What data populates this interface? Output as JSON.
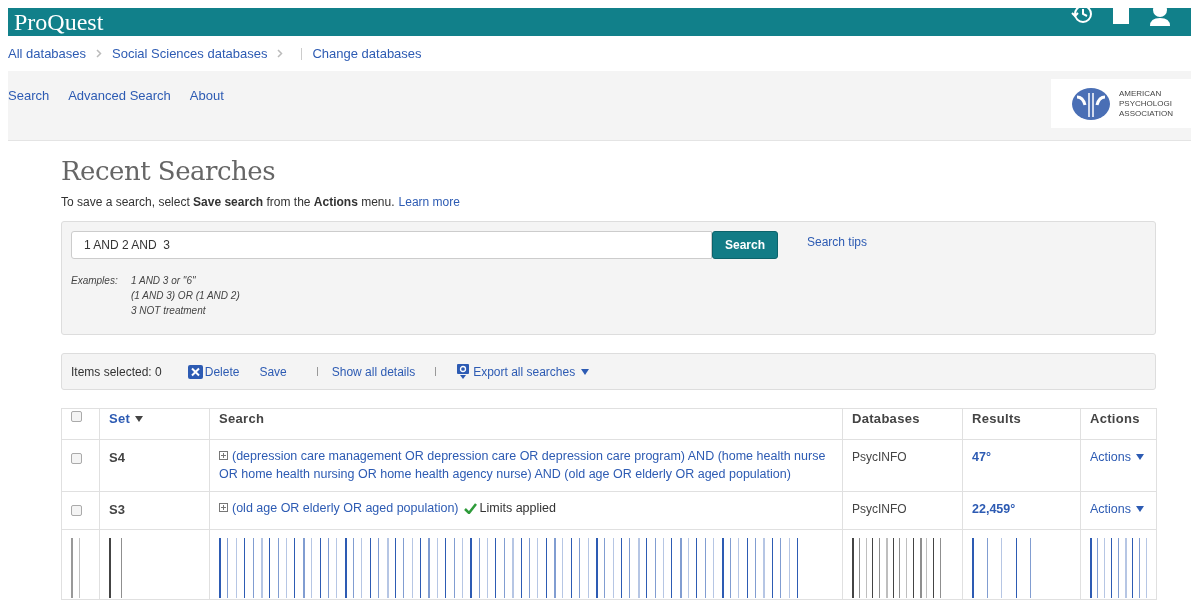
{
  "header": {
    "logo": "ProQuest"
  },
  "breadcrumbs": [
    {
      "label": "All databases",
      "kind": "crumb"
    },
    {
      "label": "Social Sciences databases",
      "kind": "crumb"
    },
    {
      "label": "Change databases",
      "kind": "link"
    }
  ],
  "nav": [
    {
      "label": "Search"
    },
    {
      "label": "Advanced Search"
    },
    {
      "label": "About"
    }
  ],
  "publisher_logo": {
    "lines": [
      "AMERICAN",
      "PSYCHOLOGI",
      "ASSOCIATION"
    ]
  },
  "page_title": "Recent Searches",
  "intro": "To save a search, select **Save search** from the **Actions** menu.",
  "intro_link": "Learn more",
  "search": {
    "value": "1 AND 2 AND  3",
    "button": "Search",
    "tips": "Search tips",
    "examples_label": "Examples:",
    "examples": [
      "1 AND 3 or \"6\"",
      "(1 AND 3) OR (1 AND 2)",
      "3 NOT treatment"
    ]
  },
  "toolbar": {
    "selected": "Items selected: 0",
    "delete": "Delete",
    "save": "Save",
    "details": "Show all details",
    "export": "Export all searches"
  },
  "table": {
    "select_all": {
      "checked": false
    },
    "columns": [
      {
        "label": "Set",
        "sortable": true
      },
      {
        "label": "Search",
        "sortable": false
      },
      {
        "label": "Databases",
        "sortable": false
      },
      {
        "label": "Results",
        "sortable": false
      },
      {
        "label": "Actions",
        "sortable": false
      }
    ],
    "rows": [
      {
        "checked": false,
        "set": "S4",
        "query": "(depression care management OR depression care OR depression care program) AND (home health nurse OR home health nursing OR home health agency nurse) AND (old age OR elderly OR aged population)",
        "database": "PsycINFO",
        "results": "47°",
        "actions": "Actions"
      },
      {
        "checked": false,
        "set": "S3",
        "query": "(old age OR elderly OR aged population)",
        "limits": "Limits applied",
        "database": "PsycINFO",
        "results": "22,459°",
        "actions": "Actions"
      }
    ]
  }
}
